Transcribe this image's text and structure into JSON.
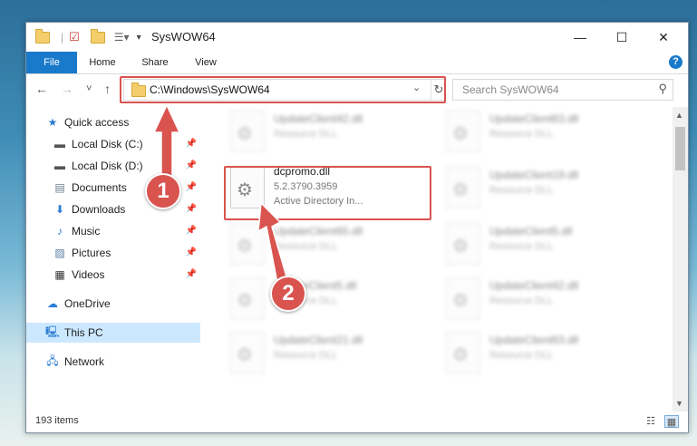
{
  "window": {
    "title": "SysWOW64",
    "controls": {
      "minimize": "—",
      "maximize": "☐",
      "close": "✕"
    }
  },
  "ribbon": {
    "tabs": [
      "File",
      "Home",
      "Share",
      "View"
    ],
    "help": "?"
  },
  "navigation": {
    "back": "←",
    "forward": "→",
    "recent": "˅",
    "up": "↑",
    "address": "C:\\Windows\\SysWOW64",
    "search_placeholder": "Search SysWOW64"
  },
  "sidebar": {
    "items": [
      {
        "label": "Quick access",
        "icon": "star-icon",
        "pinned": false
      },
      {
        "label": "Local Disk (C:)",
        "icon": "drive-icon",
        "pinned": true
      },
      {
        "label": "Local Disk (D:)",
        "icon": "drive-icon",
        "pinned": true
      },
      {
        "label": "Documents",
        "icon": "documents-icon",
        "pinned": true
      },
      {
        "label": "Downloads",
        "icon": "download-icon",
        "pinned": true
      },
      {
        "label": "Music",
        "icon": "music-icon",
        "pinned": true
      },
      {
        "label": "Pictures",
        "icon": "pictures-icon",
        "pinned": true
      },
      {
        "label": "Videos",
        "icon": "videos-icon",
        "pinned": true
      },
      {
        "label": "OneDrive",
        "icon": "cloud-icon",
        "pinned": false
      },
      {
        "label": "This PC",
        "icon": "computer-icon",
        "pinned": false,
        "selected": true
      },
      {
        "label": "Network",
        "icon": "network-icon",
        "pinned": false
      }
    ]
  },
  "files": {
    "focused": {
      "name": "dcpromo.dll",
      "version": "5.2.3790.3959",
      "description": "Active Directory In..."
    },
    "left_column": [
      {
        "name": "UpdateClient42.dll",
        "type": "Resource DLL"
      },
      {
        "name": "UpdateClient65.dll",
        "type": "Resource DLL"
      },
      {
        "name": "UpdateClient5.dll",
        "type": "Resource DLL"
      },
      {
        "name": "UpdateClient21.dll",
        "type": "Resource DLL"
      }
    ],
    "right_column": [
      {
        "name": "UpdateClient63.dll",
        "type": "Resource DLL"
      },
      {
        "name": "UpdateClient19.dll",
        "type": "Resource DLL"
      },
      {
        "name": "UpdateClient5.dll",
        "type": "Resource DLL"
      },
      {
        "name": "UpdateClient42.dll",
        "type": "Resource DLL"
      },
      {
        "name": "UpdateClient63.dll",
        "type": "Resource DLL"
      }
    ]
  },
  "status": {
    "items": "193 items"
  },
  "callouts": {
    "one": "1",
    "two": "2"
  }
}
